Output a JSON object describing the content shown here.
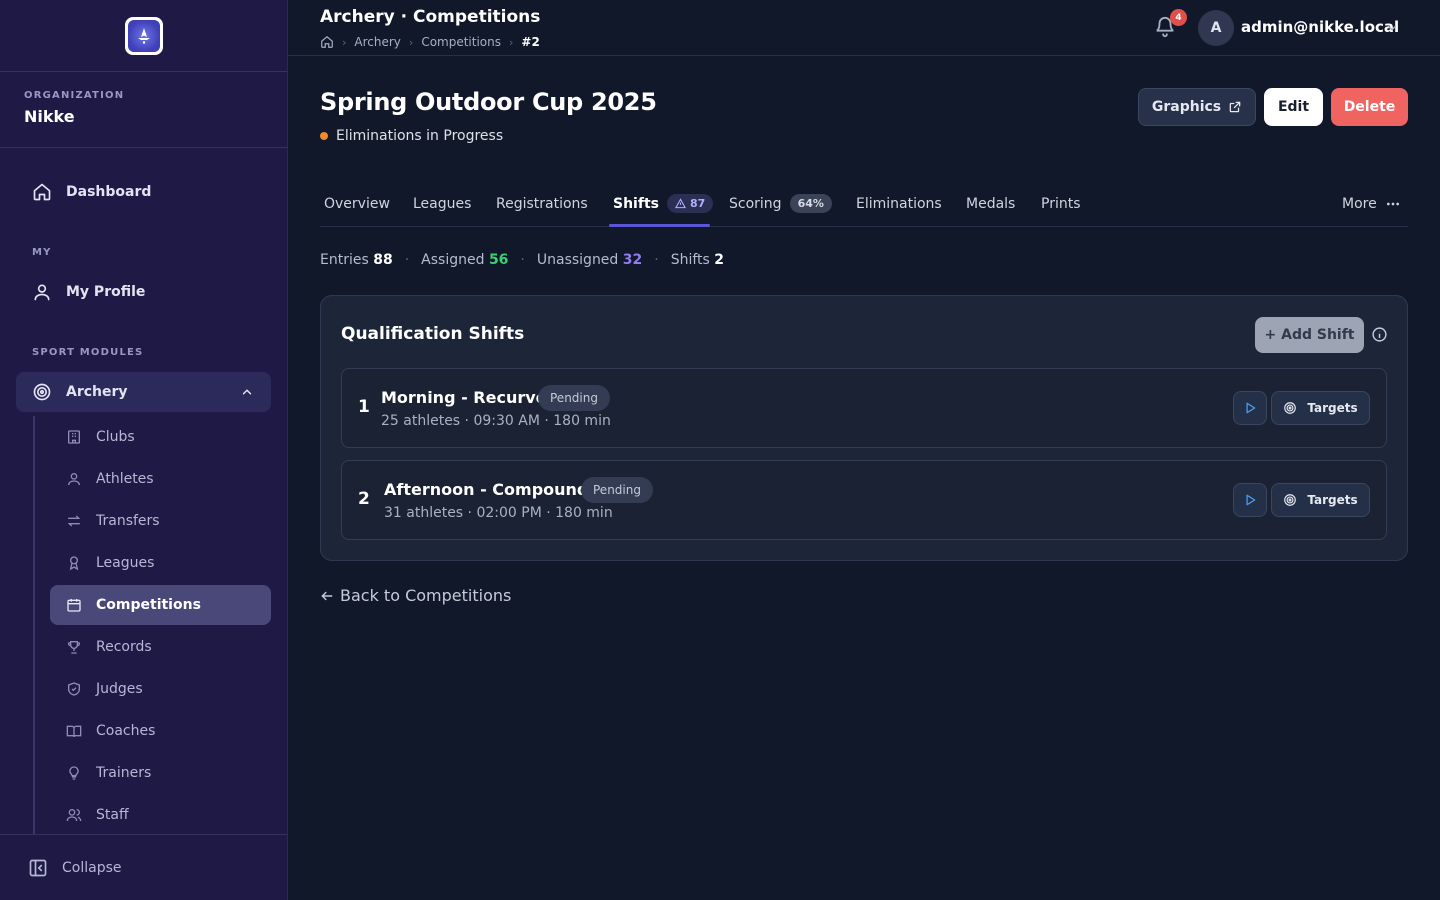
{
  "sidebar": {
    "org_label": "ORGANIZATION",
    "org_name": "Nikke",
    "dashboard": "Dashboard",
    "my_section": "MY",
    "my_profile": "My Profile",
    "modules_section": "SPORT MODULES",
    "module": "Archery",
    "sub_items": [
      "Clubs",
      "Athletes",
      "Transfers",
      "Leagues",
      "Competitions",
      "Records",
      "Judges",
      "Coaches",
      "Trainers",
      "Staff"
    ],
    "active_sub_item": "Competitions",
    "collapse": "Collapse"
  },
  "header": {
    "title": "Archery · Competitions",
    "breadcrumbs": [
      "Archery",
      "Competitions",
      "#2"
    ],
    "notification_count": "4",
    "avatar_initial": "A",
    "user_email": "admin@nikke.local"
  },
  "competition": {
    "title": "Spring Outdoor Cup 2025",
    "status": "Eliminations in Progress",
    "status_color": "#f08a2c"
  },
  "actions": {
    "graphics": "Graphics",
    "edit": "Edit",
    "delete": "Delete"
  },
  "tabs": {
    "overview": "Overview",
    "leagues": "Leagues",
    "registrations": "Registrations",
    "shifts": "Shifts",
    "shifts_badge": "87",
    "scoring": "Scoring",
    "scoring_badge": "64%",
    "eliminations": "Eliminations",
    "medals": "Medals",
    "prints": "Prints",
    "more": "More",
    "active": "Shifts"
  },
  "stats": {
    "entries_label": "Entries",
    "entries": "88",
    "assigned_label": "Assigned",
    "assigned": "56",
    "unassigned_label": "Unassigned",
    "unassigned": "32",
    "shifts_label": "Shifts",
    "shifts": "2"
  },
  "panel": {
    "title": "Qualification Shifts",
    "add_shift": "+ Add Shift",
    "shifts": [
      {
        "number": "1",
        "name": "Morning - Recurve",
        "status": "Pending",
        "meta": "25 athletes · 09:30 AM · 180 min",
        "targets": "Targets"
      },
      {
        "number": "2",
        "name": "Afternoon - Compound",
        "status": "Pending",
        "meta": "31 athletes · 02:00 PM · 180 min",
        "targets": "Targets"
      }
    ]
  },
  "back_link": "Back to Competitions",
  "colors": {
    "sidebar_bg": "#1e1a45",
    "main_bg": "#111829",
    "accent": "#5b56d6",
    "delete": "#ef6461",
    "assigned": "#3fcf73",
    "unassigned": "#8f7cf0"
  }
}
